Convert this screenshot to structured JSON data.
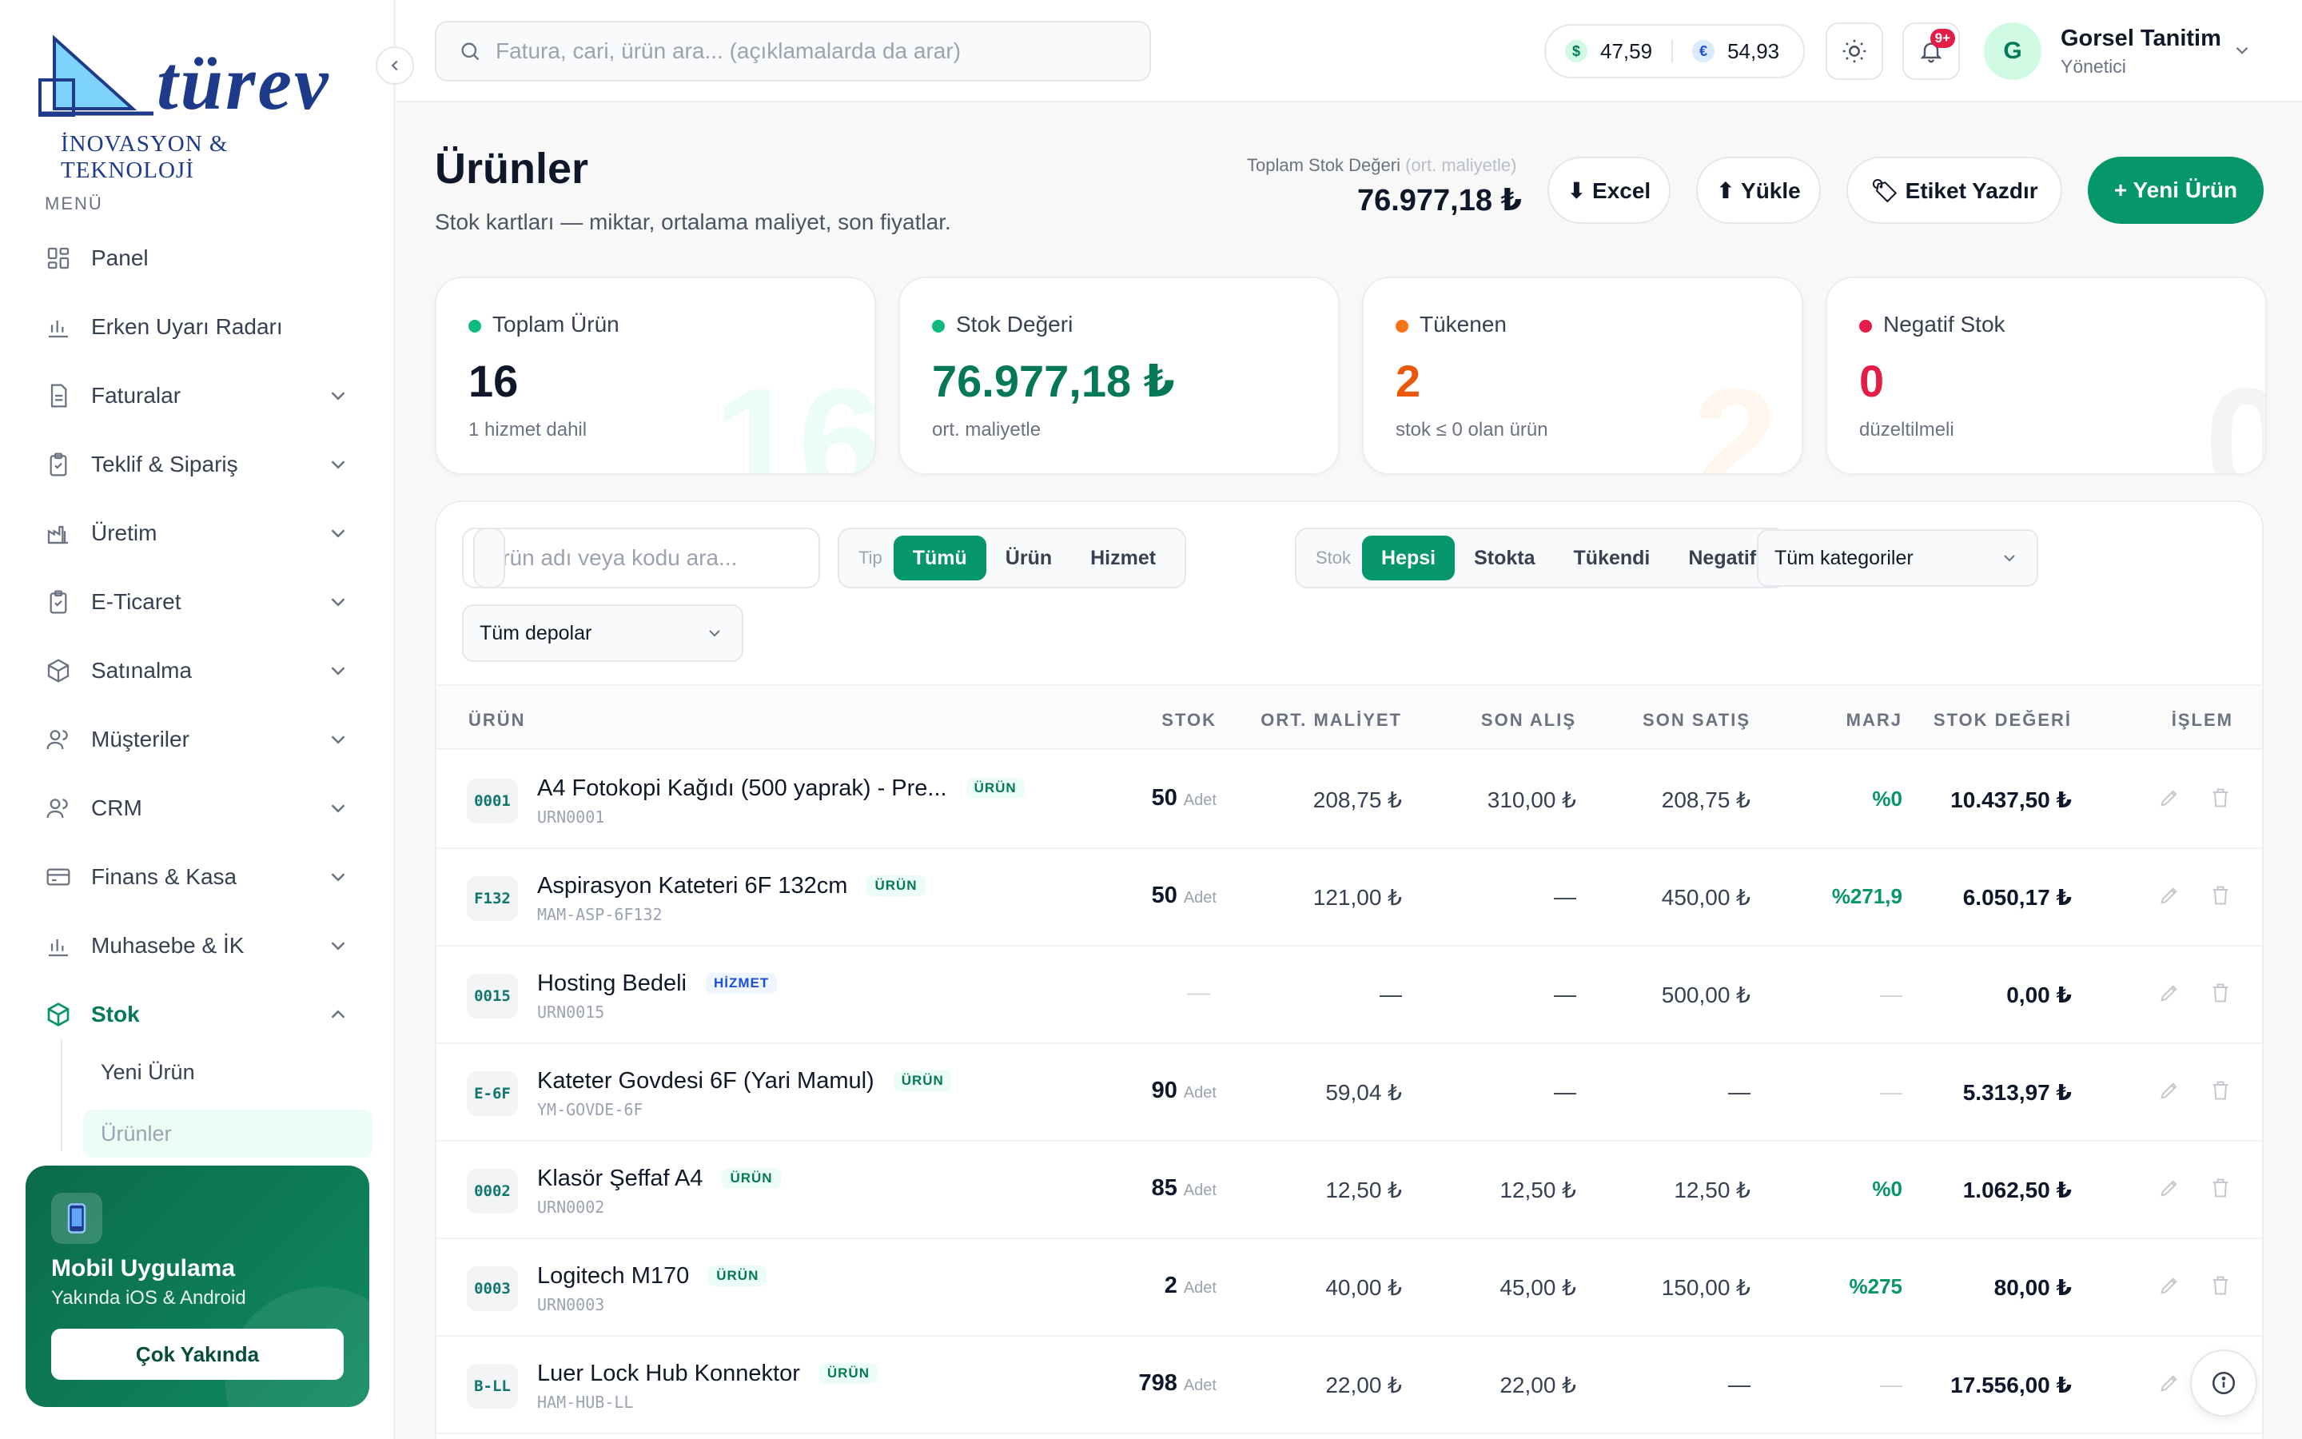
{
  "brand": {
    "name": "türev",
    "subtitle": "İNOVASYON & TEKNOLOJİ",
    "colors": {
      "navy": "#1e3a8a",
      "sky": "#60a5fa"
    }
  },
  "sidebar": {
    "menu_label": "MENÜ",
    "items": [
      {
        "label": "Panel",
        "icon": "grid-icon",
        "expandable": false
      },
      {
        "label": "Erken Uyarı Radarı",
        "icon": "bar-chart-icon",
        "expandable": false
      },
      {
        "label": "Faturalar",
        "icon": "document-icon",
        "expandable": true
      },
      {
        "label": "Teklif & Sipariş",
        "icon": "clipboard-check-icon",
        "expandable": true
      },
      {
        "label": "Üretim",
        "icon": "factory-icon",
        "expandable": true
      },
      {
        "label": "E-Ticaret",
        "icon": "clipboard-check-icon",
        "expandable": true
      },
      {
        "label": "Satınalma",
        "icon": "box-icon",
        "expandable": true
      },
      {
        "label": "Müşteriler",
        "icon": "users-icon",
        "expandable": true
      },
      {
        "label": "CRM",
        "icon": "users-icon",
        "expandable": true
      },
      {
        "label": "Finans & Kasa",
        "icon": "wallet-icon",
        "expandable": true
      },
      {
        "label": "Muhasebe & İK",
        "icon": "bar-chart-icon",
        "expandable": true
      },
      {
        "label": "Stok",
        "icon": "box-icon",
        "expandable": true,
        "active": true
      }
    ],
    "sub_items": [
      {
        "label": "Yeni Ürün"
      },
      {
        "label": "Ürünler",
        "active": true
      }
    ],
    "promo": {
      "title": "Mobil Uygulama",
      "subtitle": "Yakında iOS & Android",
      "button": "Çok Yakında"
    }
  },
  "topbar": {
    "search_placeholder": "Fatura, cari, ürün ara... (açıklamalarda da arar)",
    "rates": [
      {
        "symbol": "$",
        "value": "47,59"
      },
      {
        "symbol": "€",
        "value": "54,93"
      }
    ],
    "notification_badge": "9+",
    "user": {
      "initial": "G",
      "name": "Gorsel Tanitim",
      "role": "Yönetici"
    }
  },
  "page": {
    "title": "Ürünler",
    "subtitle": "Stok kartları — miktar, ortalama maliyet, son fiyatlar.",
    "stock_value_label": "Toplam Stok Değeri",
    "stock_value_hint": "(ort. maliyetle)",
    "stock_value": "76.977,18 ₺",
    "buttons": {
      "excel": "⬇ Excel",
      "upload": "⬆ Yükle",
      "label_print": "🏷 Etiket Yazdır",
      "new_product": "+ Yeni Ürün"
    }
  },
  "stats": [
    {
      "label": "Toplam Ürün",
      "value": "16",
      "note": "1 hizmet dahil",
      "ghost": "16",
      "dot": "#10b981",
      "value_color": "#0f172a",
      "ghost_color": "#ecfdf5"
    },
    {
      "label": "Stok Değeri",
      "value": "76.977,18 ₺",
      "note": "ort. maliyetle",
      "ghost": "",
      "dot": "#10b981",
      "value_color": "#047857",
      "ghost_color": "#ecfdf5"
    },
    {
      "label": "Tükenen",
      "value": "2",
      "note": "stok ≤ 0 olan ürün",
      "ghost": "2",
      "dot": "#f97316",
      "value_color": "#ea580c",
      "ghost_color": "#fff7ed"
    },
    {
      "label": "Negatif Stok",
      "value": "0",
      "note": "düzeltilmeli",
      "ghost": "0",
      "dot": "#e11d48",
      "value_color": "#e11d48",
      "ghost_color": "#f3f4f6"
    }
  ],
  "filters": {
    "search_placeholder": "Ürün adı veya kodu ara...",
    "type": {
      "label": "Tip",
      "options": [
        "Tümü",
        "Ürün",
        "Hizmet"
      ],
      "selected": 0
    },
    "stock": {
      "label": "Stok",
      "options": [
        "Hepsi",
        "Stokta",
        "Tükendi",
        "Negatif"
      ],
      "selected": 0
    },
    "category": "Tüm kategoriler",
    "warehouse": "Tüm depolar"
  },
  "table": {
    "columns": {
      "product": "ÜRÜN",
      "stock": "STOK",
      "avg_cost": "ORT. MALİYET",
      "last_buy": "SON ALIŞ",
      "last_sale": "SON SATIŞ",
      "margin": "MARJ",
      "stock_value": "STOK DEĞERİ",
      "action": "İŞLEM"
    },
    "rows": [
      {
        "code": "0001",
        "name": "A4 Fotokopi Kağıdı (500 yaprak) - Pre...",
        "tag": "ÜRÜN",
        "sku": "URN0001",
        "stock": "50",
        "unit": "Adet",
        "avg_cost": "208,75 ₺",
        "last_buy": "310,00 ₺",
        "last_sale": "208,75 ₺",
        "margin": "%0",
        "stock_value": "10.437,50 ₺"
      },
      {
        "code": "F132",
        "name": "Aspirasyon Kateteri 6F 132cm",
        "tag": "ÜRÜN",
        "sku": "MAM-ASP-6F132",
        "stock": "50",
        "unit": "Adet",
        "avg_cost": "121,00 ₺",
        "last_buy": "—",
        "last_sale": "450,00 ₺",
        "margin": "%271,9",
        "stock_value": "6.050,17 ₺"
      },
      {
        "code": "0015",
        "name": "Hosting Bedeli",
        "tag": "HİZMET",
        "sku": "URN0015",
        "stock": "—",
        "unit": "",
        "avg_cost": "—",
        "last_buy": "—",
        "last_sale": "500,00 ₺",
        "margin": "—",
        "stock_value": "0,00 ₺"
      },
      {
        "code": "E-6F",
        "name": "Kateter Govdesi 6F (Yari Mamul)",
        "tag": "ÜRÜN",
        "sku": "YM-GOVDE-6F",
        "stock": "90",
        "unit": "Adet",
        "avg_cost": "59,04 ₺",
        "last_buy": "—",
        "last_sale": "—",
        "margin": "—",
        "stock_value": "5.313,97 ₺"
      },
      {
        "code": "0002",
        "name": "Klasör Şeffaf A4",
        "tag": "ÜRÜN",
        "sku": "URN0002",
        "stock": "85",
        "unit": "Adet",
        "avg_cost": "12,50 ₺",
        "last_buy": "12,50 ₺",
        "last_sale": "12,50 ₺",
        "margin": "%0",
        "stock_value": "1.062,50 ₺"
      },
      {
        "code": "0003",
        "name": "Logitech M170",
        "tag": "ÜRÜN",
        "sku": "URN0003",
        "stock": "2",
        "unit": "Adet",
        "avg_cost": "40,00 ₺",
        "last_buy": "45,00 ₺",
        "last_sale": "150,00 ₺",
        "margin": "%275",
        "stock_value": "80,00 ₺"
      },
      {
        "code": "B-LL",
        "name": "Luer Lock Hub Konnektor",
        "tag": "ÜRÜN",
        "sku": "HAM-HUB-LL",
        "stock": "798",
        "unit": "Adet",
        "avg_cost": "22,00 ₺",
        "last_buy": "22,00 ₺",
        "last_sale": "—",
        "margin": "—",
        "stock_value": "17.556,00 ₺"
      }
    ]
  }
}
